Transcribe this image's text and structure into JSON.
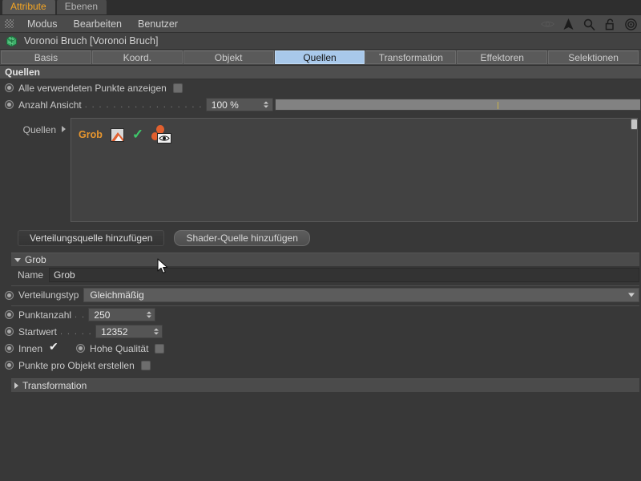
{
  "window": {
    "top_tabs": [
      {
        "label": "Attribute",
        "active": true
      },
      {
        "label": "Ebenen",
        "active": false
      }
    ],
    "menu": [
      "Modus",
      "Bearbeiten",
      "Benutzer"
    ],
    "menu_icons": [
      "eye-icon",
      "cursor-arrow-icon",
      "search-icon",
      "lock-icon",
      "target-icon"
    ]
  },
  "object": {
    "icon": "voronoi-fracture-icon",
    "title": "Voronoi Bruch [Voronoi Bruch]"
  },
  "param_tabs": [
    {
      "label": "Basis",
      "active": false
    },
    {
      "label": "Koord.",
      "active": false
    },
    {
      "label": "Objekt",
      "active": false
    },
    {
      "label": "Quellen",
      "active": true
    },
    {
      "label": "Transformation",
      "active": false
    },
    {
      "label": "Effektoren",
      "active": false
    },
    {
      "label": "Selektionen",
      "active": false
    }
  ],
  "section": {
    "title": "Quellen",
    "show_all_points": {
      "label": "Alle verwendeten Punkte anzeigen",
      "checked": false
    },
    "count_view": {
      "label": "Anzahl Ansicht",
      "dots": ". . . . . . . . . . . . . . . . .",
      "value": "100 %"
    },
    "sources_label": "Quellen",
    "sources_list": [
      {
        "name": "Grob",
        "icons": [
          "image-texture-icon",
          "green-check-icon",
          "points-visibility-icon"
        ]
      }
    ],
    "buttons": {
      "add_distribution": "Verteilungsquelle hinzufügen",
      "add_shader": "Shader-Quelle hinzufügen"
    }
  },
  "group": {
    "title": "Grob",
    "name_label": "Name",
    "name_value": "Grob",
    "distribution_type": {
      "label": "Verteilungstyp",
      "value": "Gleichmäßig"
    },
    "point_count": {
      "label": "Punktanzahl",
      "dots": ". .",
      "value": "250"
    },
    "seed": {
      "label": "Startwert",
      "dots": ". . . . .",
      "value": "12352"
    },
    "inside": {
      "label": "Innen",
      "checked": true
    },
    "high_quality": {
      "label": "Hohe Qualität",
      "checked": false
    },
    "points_per_object": {
      "label": "Punkte pro Objekt erstellen",
      "checked": false
    },
    "transformation_label": "Transformation"
  },
  "colors": {
    "accent_tab": "#a8c8ea",
    "active_tab_text": "#f5a623",
    "source_name": "#e8962e",
    "check_green": "#3ec86a"
  }
}
